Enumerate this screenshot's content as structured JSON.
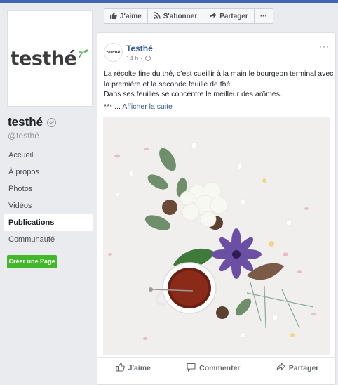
{
  "page": {
    "logo_text": "testhé",
    "name": "testhé",
    "handle": "@testhé"
  },
  "nav": {
    "items": [
      {
        "label": "Accueil"
      },
      {
        "label": "À propos"
      },
      {
        "label": "Photos"
      },
      {
        "label": "Vidéos"
      },
      {
        "label": "Publications",
        "active": true
      },
      {
        "label": "Communauté"
      }
    ]
  },
  "create_page_label": "Créer une Page",
  "action_bar": {
    "like": "J'aime",
    "follow": "S'abonner",
    "share": "Partager",
    "more": "···"
  },
  "post": {
    "avatar_text": "testhé",
    "author": "Testhé",
    "time": "14 h ·",
    "more": "···",
    "text_line1": "La récolte fine du thé, c’est cueillir à la main le bourgeon terminal avec la première et la seconde feuille de thé.",
    "text_line2": "Dans ses feuilles se concentre le meilleur des arômes.",
    "ellipsis": "*** ...",
    "see_more": "Afficher la suite",
    "actions": {
      "like": "J'aime",
      "comment": "Commenter",
      "share": "Partager"
    }
  },
  "colors": {
    "brand_blue": "#4267b2",
    "link_blue": "#365899",
    "green": "#42b72a",
    "background": "#e9ebee"
  }
}
